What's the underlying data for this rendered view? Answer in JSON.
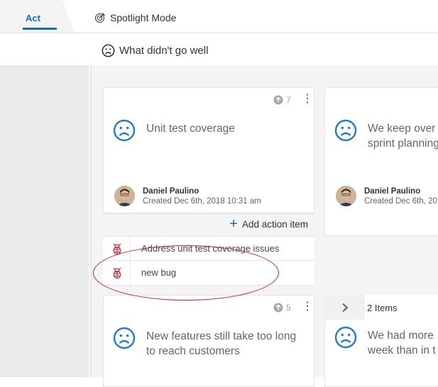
{
  "tabs": {
    "active": "Act",
    "spotlight_label": "Spotlight Mode"
  },
  "column": {
    "title": "What didn't go well"
  },
  "cards": [
    {
      "title_lines": [
        "Unit test coverage"
      ],
      "votes": "7",
      "author": "Daniel Paulino",
      "date": "Created Dec 6th, 2018 10:31 am"
    },
    {
      "title_lines": [
        "We keep over",
        "sprint planning"
      ],
      "author": "Daniel Paulino",
      "date": "Created Dec 6th, 20"
    },
    {
      "title_lines": [
        "New features still take too long",
        "to reach customers"
      ],
      "votes": "5"
    },
    {
      "title_lines": [
        "We had more",
        "week than in t"
      ]
    }
  ],
  "action": {
    "add_label": "Add action item"
  },
  "work_items": [
    "Address unit test coverage issues",
    "new bug"
  ],
  "group": {
    "count_label": "2 Items"
  },
  "colors": {
    "accent": "#106ebe",
    "annotation": "#d0202a",
    "bug": "#c53a42"
  }
}
